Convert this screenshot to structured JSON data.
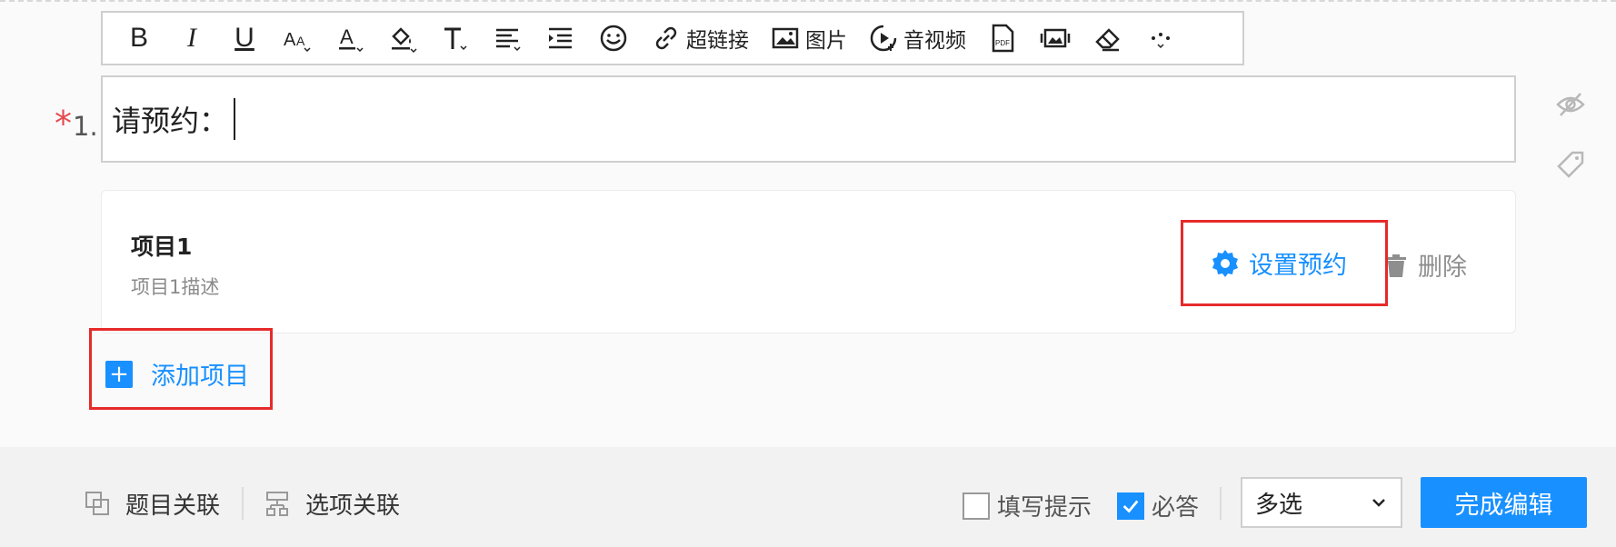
{
  "toolbar": {
    "buttons": [
      {
        "name": "bold",
        "glyph": "B"
      },
      {
        "name": "italic",
        "glyph": "I"
      },
      {
        "name": "underline",
        "glyph": "U"
      }
    ],
    "link_label": "超链接",
    "image_label": "图片",
    "media_label": "音视频"
  },
  "question": {
    "required_mark": "*",
    "number": "1.",
    "text": "请预约："
  },
  "item": {
    "title": "项目1",
    "description": "项目1描述",
    "set_label": "设置预约",
    "delete_label": "删除"
  },
  "add_item_label": "添加项目",
  "add_item_plus": "+",
  "footer": {
    "question_link_label": "题目关联",
    "option_link_label": "选项关联",
    "hint_label": "填写提示",
    "hint_checked": false,
    "required_label": "必答",
    "required_checked": true,
    "select_value": "多选",
    "done_label": "完成编辑"
  },
  "colors": {
    "accent": "#1890ff",
    "highlight": "#e62a2a",
    "required": "#e5484d"
  }
}
